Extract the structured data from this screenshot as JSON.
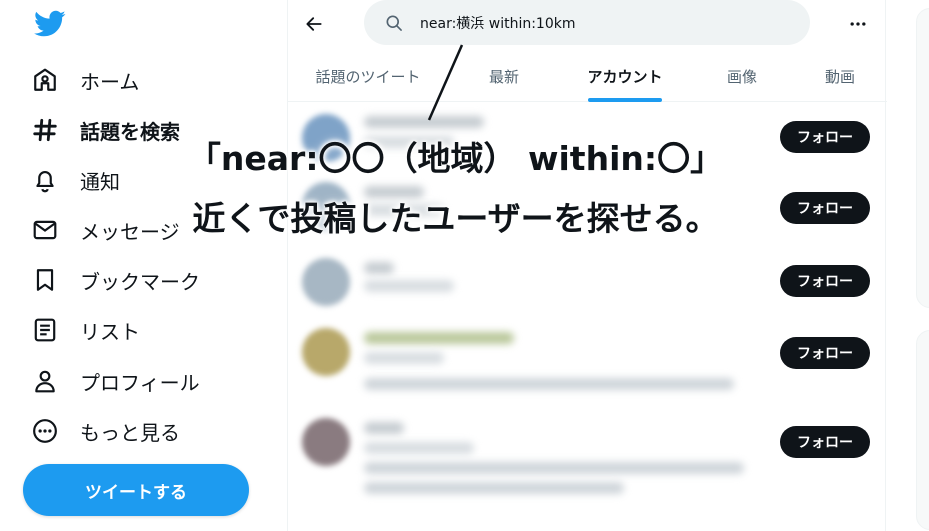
{
  "sidebar": {
    "logo": "twitter-bird-icon",
    "items": [
      {
        "label": "ホーム",
        "icon": "home-icon"
      },
      {
        "label": "話題を検索",
        "icon": "hashtag-icon"
      },
      {
        "label": "通知",
        "icon": "bell-icon"
      },
      {
        "label": "メッセージ",
        "icon": "envelope-icon"
      },
      {
        "label": "ブックマーク",
        "icon": "bookmark-icon"
      },
      {
        "label": "リスト",
        "icon": "list-icon"
      },
      {
        "label": "プロフィール",
        "icon": "person-icon"
      },
      {
        "label": "もっと見る",
        "icon": "more-circle-icon"
      }
    ],
    "tweet_button": "ツイートする"
  },
  "search": {
    "query": "near:横浜 within:10km"
  },
  "tabs": [
    {
      "label": "話題のツイート"
    },
    {
      "label": "最新"
    },
    {
      "label": "アカウント"
    },
    {
      "label": "画像"
    },
    {
      "label": "動画"
    }
  ],
  "active_tab": "アカウント",
  "accounts": {
    "follow_label": "フォロー",
    "count": 5
  },
  "overlay": {
    "line1": "「near:〇〇（地域） within:〇」",
    "line2": "近くで投稿したユーザーを探せる。"
  },
  "colors": {
    "accent": "#1d9bf0",
    "text": "#0f1419",
    "muted": "#536471",
    "search_bg": "#eff3f4",
    "follow_bg": "#0f1419"
  }
}
